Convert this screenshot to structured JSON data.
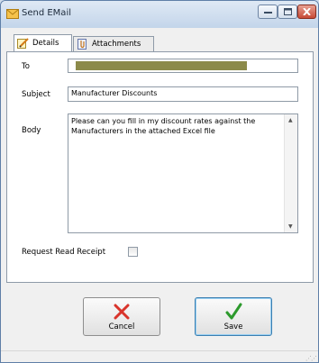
{
  "window": {
    "title": "Send EMail",
    "icon": "envelope-icon",
    "controls": {
      "minimize": "minimize-icon",
      "maximize": "maximize-icon",
      "close": "close-icon"
    }
  },
  "tabs": [
    {
      "label": "Details",
      "icon": "pencil-notepad-icon",
      "active": true
    },
    {
      "label": "Attachments",
      "icon": "paperclip-document-icon",
      "active": false
    }
  ],
  "form": {
    "to": {
      "label": "To",
      "value": ""
    },
    "subject": {
      "label": "Subject",
      "value": "Manufacturer Discounts"
    },
    "body": {
      "label": "Body",
      "value": "Please can you fill in my discount rates against the Manufacturers in the attached Excel file"
    },
    "read_receipt": {
      "label": "Request Read Receipt",
      "checked": false
    }
  },
  "buttons": {
    "cancel": {
      "label": "Cancel",
      "icon": "red-x-icon"
    },
    "save": {
      "label": "Save",
      "icon": "green-check-icon"
    }
  },
  "colors": {
    "redacted_to": "#8c8a4a",
    "cancel_icon": "#d9342b",
    "save_icon": "#2d9a2d",
    "close_button": "#c74a36"
  }
}
